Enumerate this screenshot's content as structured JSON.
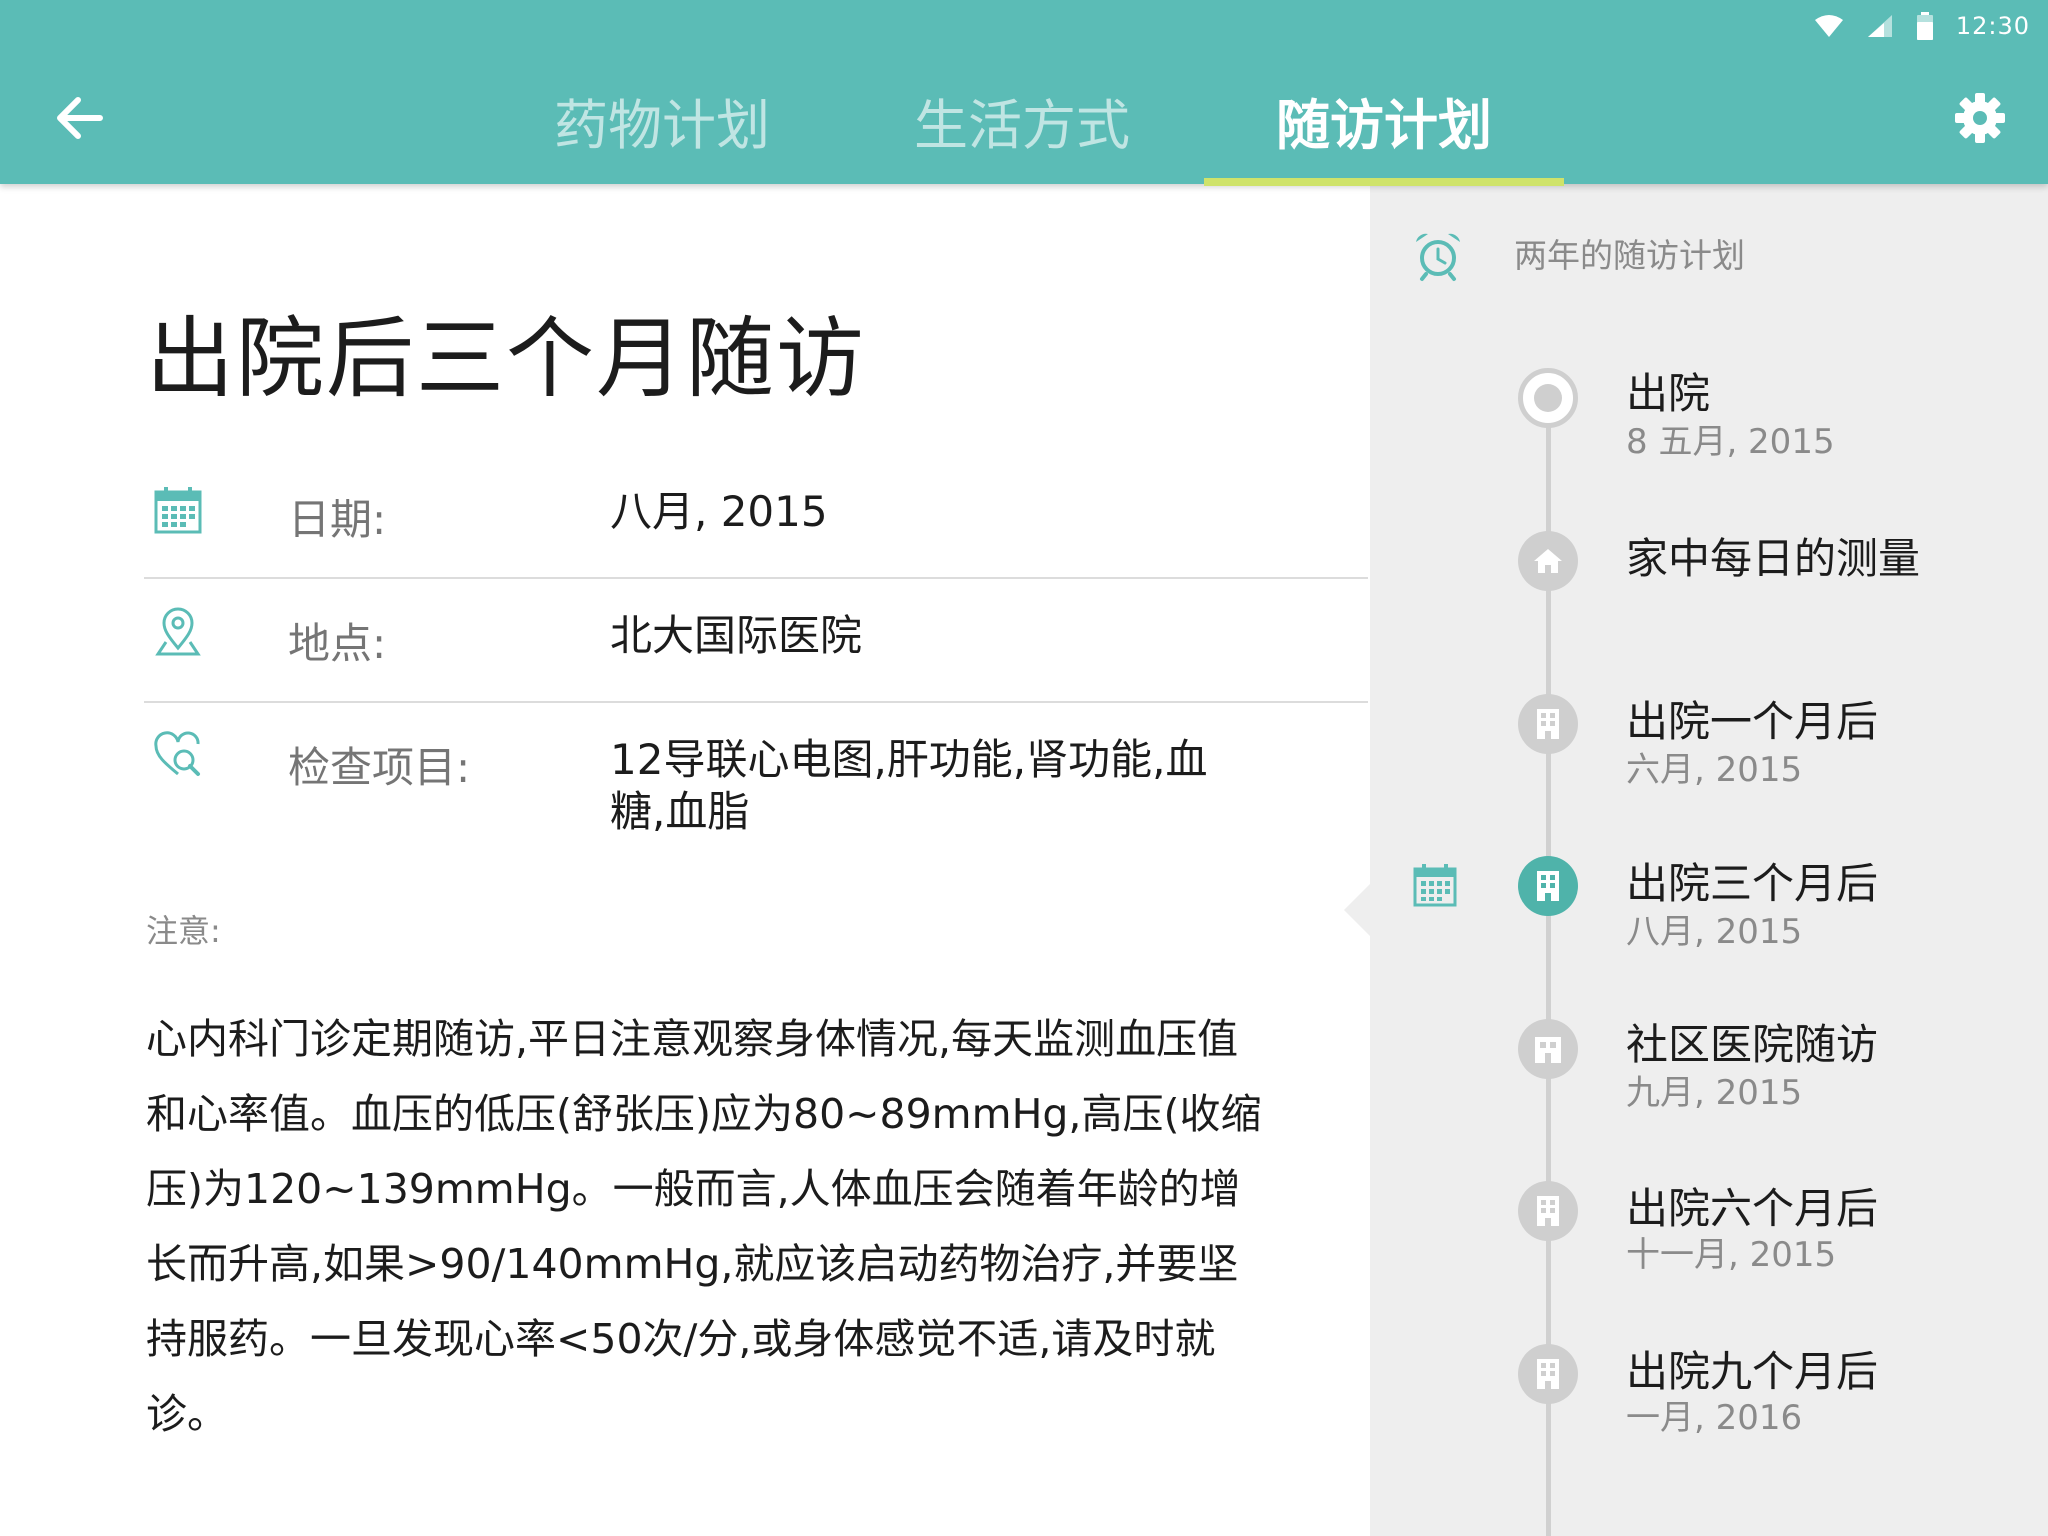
{
  "status_bar": {
    "time": "12:30",
    "icons": [
      "wifi-icon",
      "signal-icon",
      "battery-icon"
    ]
  },
  "app_bar": {
    "back_icon": "arrow-left-icon",
    "settings_icon": "gear-icon",
    "tabs": [
      {
        "label": "药物计划",
        "active": false
      },
      {
        "label": "生活方式",
        "active": false
      },
      {
        "label": "随访计划",
        "active": true
      }
    ]
  },
  "detail": {
    "title": "出院后三个月随访",
    "fields": [
      {
        "icon": "calendar-icon",
        "label": "日期:",
        "value": "八月, 2015"
      },
      {
        "icon": "location-pin-icon",
        "label": "地点:",
        "value": "北大国际医院"
      },
      {
        "icon": "heart-search-icon",
        "label": "检查项目:",
        "value": "12导联心电图,肝功能,肾功能,血糖,血脂"
      }
    ],
    "note_label": "注意:",
    "note_text": "心内科门诊定期随访,平日注意观察身体情况,每天监测血压值和心率值。血压的低压(舒张压)应为80~89mmHg,高压(收缩压)为120~139mmHg。一般而言,人体血压会随着年龄的增长而升高,如果>90/140mmHg,就应该启动药物治疗,并要坚持服药。一旦发现心率<50次/分,或身体感觉不适,请及时就诊。"
  },
  "timeline": {
    "header": "两年的随访计划",
    "header_icon": "alarm-clock-icon",
    "items": [
      {
        "title": "出院",
        "date": "8 五月, 2015",
        "icon": "ring-icon",
        "active": false
      },
      {
        "title": "家中每日的测量",
        "date": "",
        "icon": "home-icon",
        "active": false
      },
      {
        "title": "出院一个月后",
        "date": "六月, 2015",
        "icon": "hospital-icon",
        "active": false
      },
      {
        "title": "出院三个月后",
        "date": "八月, 2015",
        "icon": "hospital-icon",
        "active": true
      },
      {
        "title": "社区医院随访",
        "date": "九月, 2015",
        "icon": "clinic-icon",
        "active": false
      },
      {
        "title": "出院六个月后",
        "date": "十一月, 2015",
        "icon": "hospital-icon",
        "active": false
      },
      {
        "title": "出院九个月后",
        "date": "一月, 2016",
        "icon": "hospital-icon",
        "active": false
      }
    ]
  },
  "colors": {
    "accent": "#5bbcb6",
    "tab_indicator": "#cfe36a",
    "panel_bg": "#eeeeee",
    "timeline_active": "#4fb3aa"
  }
}
